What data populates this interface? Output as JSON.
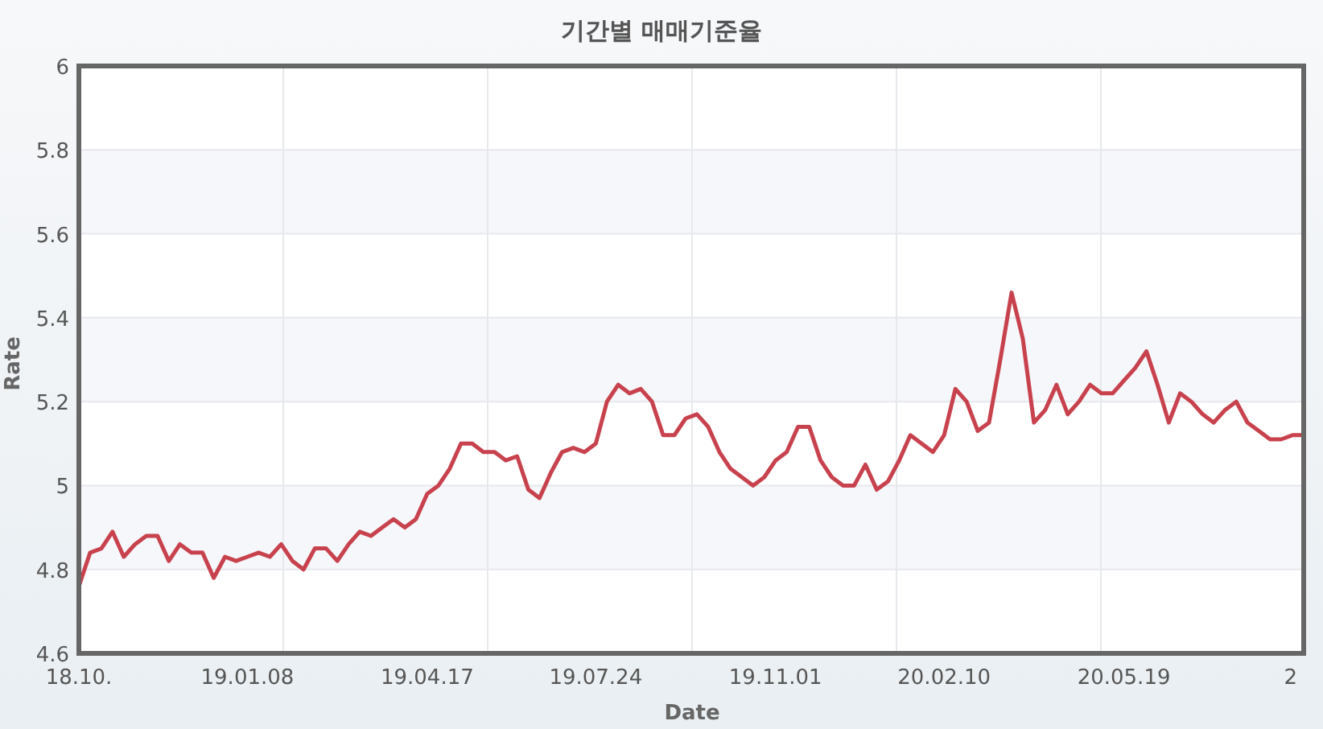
{
  "chart": {
    "title": "기간별 매매기준율",
    "chart_data": {
      "type": "line",
      "grid": true,
      "xlabel": "Date",
      "ylabel": "Rate",
      "categories": [
        "18.10.",
        null,
        null,
        null,
        null,
        null,
        null,
        null,
        null,
        null,
        null,
        null,
        null,
        null,
        null,
        "19.01.08",
        null,
        null,
        null,
        null,
        null,
        null,
        null,
        null,
        null,
        null,
        null,
        null,
        null,
        null,
        null,
        "19.04.17",
        null,
        null,
        null,
        null,
        null,
        null,
        null,
        null,
        null,
        null,
        null,
        null,
        null,
        null,
        "19.07.24",
        null,
        null,
        null,
        null,
        null,
        null,
        null,
        null,
        null,
        null,
        null,
        null,
        null,
        null,
        null,
        "19.11.01",
        null,
        null,
        null,
        null,
        null,
        null,
        null,
        null,
        null,
        null,
        null,
        null,
        null,
        null,
        "20.02.10",
        null,
        null,
        null,
        null,
        null,
        null,
        null,
        null,
        null,
        null,
        null,
        null,
        null,
        null,
        null,
        "20.05.19",
        null,
        null,
        null,
        null,
        null,
        null,
        null,
        null,
        null,
        null,
        null,
        null,
        null,
        null,
        "2",
        null
      ],
      "series": [
        {
          "color": "#c8424e",
          "values": [
            4.76,
            4.84,
            4.85,
            4.89,
            4.83,
            4.86,
            4.88,
            4.88,
            4.82,
            4.86,
            4.84,
            4.84,
            4.78,
            4.83,
            4.82,
            4.83,
            4.84,
            4.83,
            4.86,
            4.82,
            4.8,
            4.85,
            4.85,
            4.82,
            4.86,
            4.89,
            4.88,
            4.9,
            4.92,
            4.9,
            4.92,
            4.98,
            5.0,
            5.04,
            5.1,
            5.1,
            5.08,
            5.08,
            5.06,
            5.07,
            4.99,
            4.97,
            5.03,
            5.08,
            5.09,
            5.08,
            5.1,
            5.2,
            5.24,
            5.22,
            5.23,
            5.2,
            5.12,
            5.12,
            5.16,
            5.17,
            5.14,
            5.08,
            5.04,
            5.02,
            5.0,
            5.02,
            5.06,
            5.08,
            5.14,
            5.14,
            5.06,
            5.02,
            5.0,
            5.0,
            5.05,
            4.99,
            5.01,
            5.06,
            5.12,
            5.1,
            5.08,
            5.12,
            5.23,
            5.2,
            5.13,
            5.15,
            5.3,
            5.46,
            5.35,
            5.15,
            5.18,
            5.24,
            5.17,
            5.2,
            5.24,
            5.22,
            5.22,
            5.25,
            5.28,
            5.32,
            5.24,
            5.15,
            5.22,
            5.2,
            5.17,
            5.15,
            5.18,
            5.2,
            5.15,
            5.13,
            5.11,
            5.11,
            5.12,
            5.12
          ]
        }
      ],
      "ylim": [
        4.6,
        6
      ],
      "yticks": [
        {
          "value": 4.6,
          "label": "4.6"
        },
        {
          "value": 4.8,
          "label": "4.8"
        },
        {
          "value": 5,
          "label": "5"
        },
        {
          "value": 5.2,
          "label": "5.2"
        },
        {
          "value": 5.4,
          "label": "5.4"
        },
        {
          "value": 5.6,
          "label": "5.6"
        },
        {
          "value": 5.8,
          "label": "5.8"
        },
        {
          "value": 6,
          "label": "6"
        }
      ]
    }
  }
}
